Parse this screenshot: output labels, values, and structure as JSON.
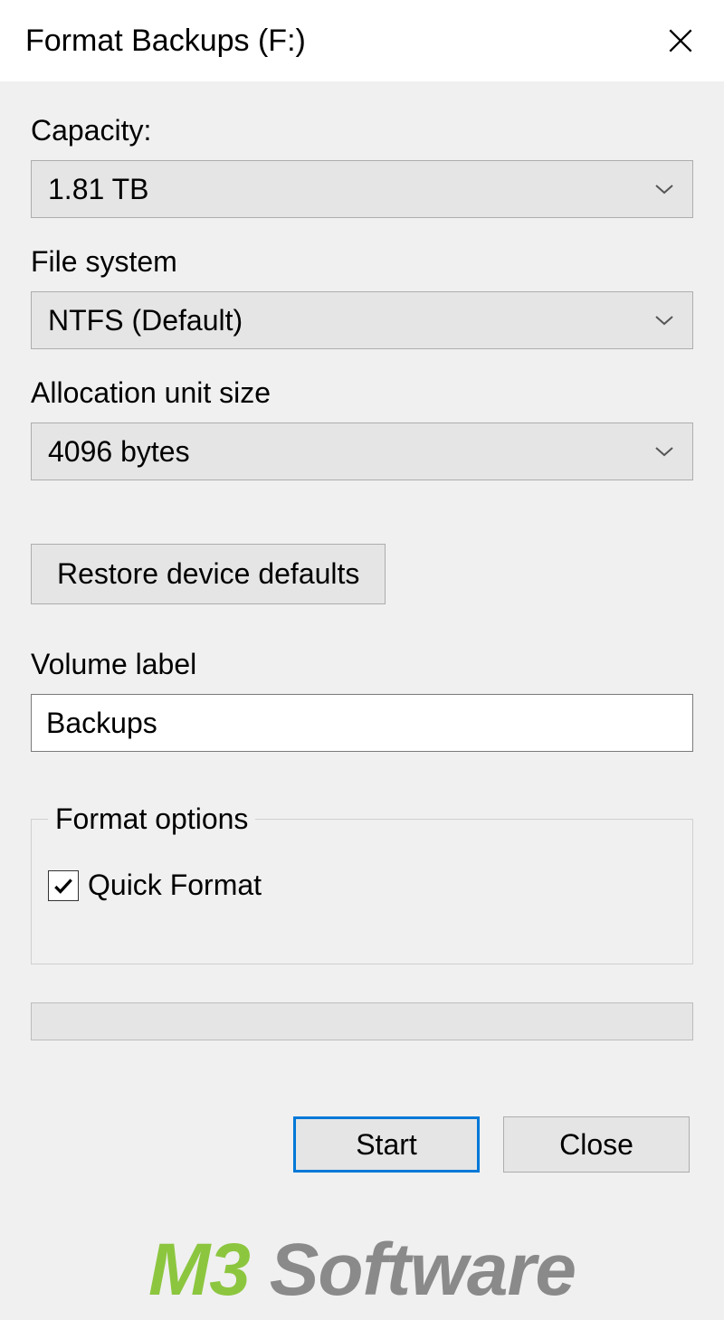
{
  "titlebar": {
    "title": "Format Backups (F:)"
  },
  "capacity": {
    "label": "Capacity:",
    "value": "1.81 TB"
  },
  "filesystem": {
    "label": "File system",
    "value": "NTFS (Default)"
  },
  "allocation": {
    "label": "Allocation unit size",
    "value": "4096 bytes"
  },
  "restore_button": "Restore device defaults",
  "volume": {
    "label": "Volume label",
    "value": "Backups"
  },
  "format_options": {
    "legend": "Format options",
    "quick_format_label": "Quick Format",
    "quick_format_checked": true
  },
  "buttons": {
    "start": "Start",
    "close": "Close"
  },
  "watermark": {
    "part1": "M3",
    "part2": " Software"
  }
}
